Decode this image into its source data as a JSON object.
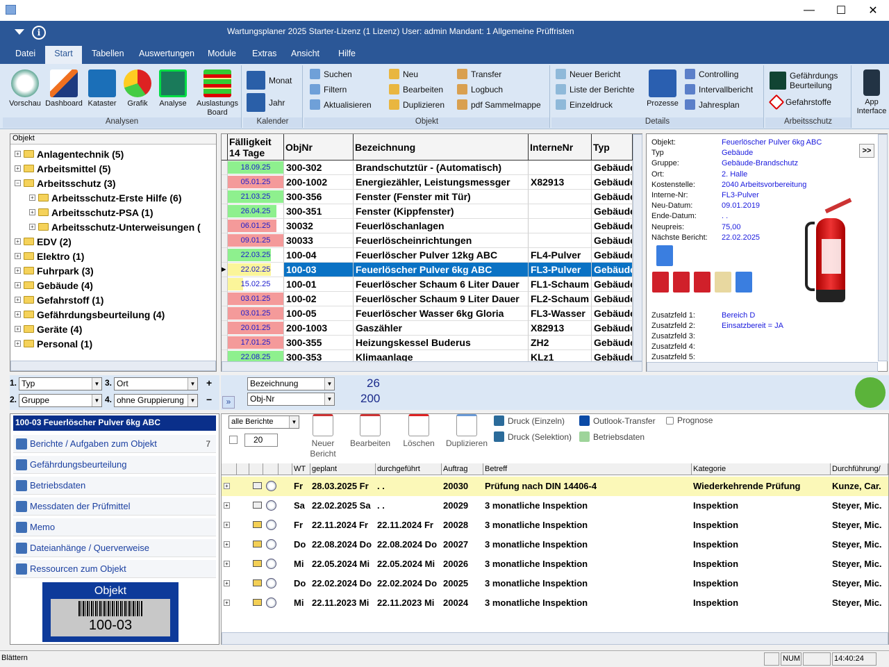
{
  "window": {
    "title": "Wartungsplaner 2025 Starter-Lizenz (1 Lizenz)   User: admin   Mandant: 1 Allgemeine Prüffristen",
    "minimize": "—",
    "maximize": "☐",
    "close": "✕"
  },
  "menu": [
    "Datei",
    "Start",
    "Tabellen",
    "Auswertungen",
    "Module",
    "Extras",
    "Ansicht",
    "Hilfe"
  ],
  "menu_active": "Start",
  "ribbon": {
    "analysen": {
      "label": "Analysen",
      "buttons": [
        "Vorschau",
        "Dashboard",
        "Kataster",
        "Grafik",
        "Analyse",
        "Auslastungs Board"
      ]
    },
    "kalender": {
      "label": "Kalender",
      "buttons": [
        "Monat",
        "Jahr"
      ]
    },
    "objekt": {
      "label": "Objekt",
      "col1": [
        "Suchen",
        "Filtern",
        "Aktualisieren"
      ],
      "col2": [
        "Neu",
        "Bearbeiten",
        "Duplizieren"
      ],
      "col3": [
        "Transfer",
        "Logbuch",
        "pdf Sammelmappe"
      ]
    },
    "details": {
      "label": "Details",
      "col1": [
        "Neuer Bericht",
        "Liste der Berichte",
        "Einzeldruck"
      ],
      "big": "Prozesse",
      "col2": [
        "Controlling",
        "Intervallbericht",
        "Jahresplan"
      ]
    },
    "arbeitsschutz": {
      "label": "Arbeitsschutz",
      "items": [
        "Gefährdungs Beurteilung",
        "Gefahrstoffe"
      ]
    },
    "app": {
      "label": "App Interface"
    }
  },
  "tree": {
    "header": "Objekt",
    "nodes": [
      {
        "label": "Anlagentechnik  (5)",
        "level": 0,
        "expanded": false
      },
      {
        "label": "Arbeitsmittel  (5)",
        "level": 0,
        "expanded": false
      },
      {
        "label": "Arbeitsschutz  (3)",
        "level": 0,
        "expanded": true
      },
      {
        "label": "Arbeitsschutz-Erste Hilfe  (6)",
        "level": 1,
        "expanded": false
      },
      {
        "label": "Arbeitsschutz-PSA  (1)",
        "level": 1,
        "expanded": false
      },
      {
        "label": "Arbeitsschutz-Unterweisungen  (",
        "level": 1,
        "expanded": false
      },
      {
        "label": "EDV  (2)",
        "level": 0,
        "expanded": false
      },
      {
        "label": "Elektro  (1)",
        "level": 0,
        "expanded": false
      },
      {
        "label": "Fuhrpark  (3)",
        "level": 0,
        "expanded": false
      },
      {
        "label": "Gebäude  (4)",
        "level": 0,
        "expanded": false
      },
      {
        "label": "Gefahrstoff  (1)",
        "level": 0,
        "expanded": false
      },
      {
        "label": "Gefährdungsbeurteilung  (4)",
        "level": 0,
        "expanded": false
      },
      {
        "label": "Geräte  (4)",
        "level": 0,
        "expanded": false
      },
      {
        "label": "Personal  (1)",
        "level": 0,
        "expanded": false
      }
    ]
  },
  "objects": {
    "columns": [
      "Fälligkeit 14 Tage",
      "ObjNr",
      "Bezeichnung",
      "InterneNr",
      "Typ"
    ],
    "colors": {
      "green": "#8ef08e",
      "red": "#f49a9a",
      "yellow": "#fbf59a",
      "selected": "#0a72c4"
    },
    "rows": [
      {
        "due": "18.09.25",
        "status": "green",
        "level": 1,
        "objnr": "300-302",
        "bez": "Brandschutztür - (Automatisch)",
        "intern": "",
        "typ": "Gebäude"
      },
      {
        "due": "05.01.25",
        "status": "red",
        "level": 1,
        "objnr": "200-1002",
        "bez": "Energiezähler, Leistungsmessger",
        "intern": "X82913",
        "typ": "Gebäude"
      },
      {
        "due": "21.03.25",
        "status": "green",
        "level": 1,
        "objnr": "300-356",
        "bez": "Fenster  (Fenster mit Tür)",
        "intern": "",
        "typ": "Gebäude"
      },
      {
        "due": "26.04.25",
        "status": "green",
        "level": 0.88,
        "objnr": "300-351",
        "bez": "Fenster  (Kippfenster)",
        "intern": "",
        "typ": "Gebäude"
      },
      {
        "due": "06.01.25",
        "status": "red",
        "level": 0.88,
        "objnr": "30032",
        "bez": "Feuerlöschanlagen",
        "intern": "",
        "typ": "Gebäude"
      },
      {
        "due": "09.01.25",
        "status": "red",
        "level": 1,
        "objnr": "30033",
        "bez": "Feuerlöscheinrichtungen",
        "intern": "",
        "typ": "Gebäude"
      },
      {
        "due": "22.03.25",
        "status": "green",
        "level": 0.78,
        "objnr": "100-04",
        "bez": "Feuerlöscher Pulver 12kg ABC",
        "intern": "FL4-Pulver",
        "typ": "Gebäude"
      },
      {
        "due": "22.02.25",
        "status": "yellow",
        "level": 0.78,
        "objnr": "100-03",
        "bez": "Feuerlöscher Pulver 6kg ABC",
        "intern": "FL3-Pulver",
        "typ": "Gebäude",
        "selected": true
      },
      {
        "due": "15.02.25",
        "status": "yellow",
        "level": 0.27,
        "objnr": "100-01",
        "bez": "Feuerlöscher Schaum 6 Liter Dauer",
        "intern": "FL1-Schaum",
        "typ": "Gebäude"
      },
      {
        "due": "03.01.25",
        "status": "red",
        "level": 1,
        "objnr": "100-02",
        "bez": "Feuerlöscher Schaum 9 Liter Dauer",
        "intern": "FL2-Schaum",
        "typ": "Gebäude"
      },
      {
        "due": "03.01.25",
        "status": "red",
        "level": 1,
        "objnr": "100-05",
        "bez": "Feuerlöscher Wasser 6kg Gloria",
        "intern": "FL3-Wasser",
        "typ": "Gebäude"
      },
      {
        "due": "20.01.25",
        "status": "red",
        "level": 1,
        "objnr": "200-1003",
        "bez": "Gaszähler",
        "intern": "X82913",
        "typ": "Gebäude"
      },
      {
        "due": "17.01.25",
        "status": "red",
        "level": 1,
        "objnr": "300-355",
        "bez": "Heizungskessel Buderus",
        "intern": "ZH2",
        "typ": "Gebäude"
      },
      {
        "due": "22.08.25",
        "status": "green",
        "level": 1,
        "objnr": "300-353",
        "bez": "Klimaanlage",
        "intern": "KLz1",
        "typ": "Gebäude"
      }
    ]
  },
  "detail": {
    "expand": ">>",
    "fields": [
      {
        "label": "Objekt:",
        "value": "Feuerlöscher Pulver 6kg ABC"
      },
      {
        "label": "Typ",
        "value": "Gebäude"
      },
      {
        "label": "Gruppe:",
        "value": "Gebäude-Brandschutz"
      },
      {
        "label": "Ort:",
        "value": "2. Halle"
      },
      {
        "label": "Kostenstelle:",
        "value": "2040 Arbeitsvorbereitung"
      },
      {
        "label": "Interne-Nr:",
        "value": "FL3-Pulver"
      },
      {
        "label": "Neu-Datum:",
        "value": "09.01.2019"
      },
      {
        "label": "Ende-Datum:",
        "value": ". ."
      },
      {
        "label": "Neupreis:",
        "value": "75,00"
      },
      {
        "label": "Nächste Bericht:",
        "value": "22.02.2025"
      }
    ],
    "extra": [
      {
        "label": "Zusatzfeld 1:",
        "value": "Bereich D"
      },
      {
        "label": "Zusatzfeld 2:",
        "value": "Einsatzbereit = JA"
      },
      {
        "label": "Zusatzfeld 3:",
        "value": ""
      },
      {
        "label": "Zusatzfeld 4:",
        "value": ""
      },
      {
        "label": "Zusatzfeld 5:",
        "value": ""
      }
    ],
    "attachments": [
      "doc",
      "pdf",
      "pdf",
      "pdf",
      "map",
      "doc"
    ]
  },
  "filter": {
    "g1_num": "1.",
    "g1": "Typ",
    "g2_num": "2.",
    "g2": "Gruppe",
    "g3_num": "3.",
    "g3": "Ort",
    "g4_num": "4.",
    "g4": "ohne Gruppierung",
    "add": "+",
    "remove": "−"
  },
  "sort": {
    "s1": "Bezeichnung",
    "s2": "Obj-Nr",
    "count1": "26",
    "count2": "200",
    "collapse": "»"
  },
  "left": {
    "selected": "100-03 Feuerlöscher Pulver 6kg ABC",
    "items": [
      {
        "label": "Berichte / Aufgaben zum Objekt",
        "count": "7"
      },
      {
        "label": "Gefährdungsbeurteilung",
        "count": ""
      },
      {
        "label": "Betriebsdaten",
        "count": ""
      },
      {
        "label": "Messdaten der Prüfmittel",
        "count": ""
      },
      {
        "label": "Memo",
        "count": ""
      },
      {
        "label": "Dateianhänge / Querverweise",
        "count": ""
      },
      {
        "label": "Ressourcen zum Objekt",
        "count": ""
      }
    ],
    "barcode": {
      "title": "Objekt",
      "code": "100-03"
    }
  },
  "reports_toolbar": {
    "filter": "alle Berichte",
    "count": "20",
    "buttons": [
      "Neuer Bericht",
      "Bearbeiten",
      "Löschen",
      "Duplizieren"
    ],
    "print1": "Druck (Einzeln)",
    "print2": "Druck (Selektion)",
    "outlook": "Outlook-Transfer",
    "betrieb": "Betriebsdaten",
    "prognose": "Prognose"
  },
  "reports": {
    "columns": [
      "",
      "",
      "",
      "",
      "WT",
      "geplant",
      "durchgeführt",
      "Auftrag",
      "Betreff",
      "Kategorie",
      "Durchführung/"
    ],
    "rows": [
      {
        "wt": "Fr",
        "geplant": "28.03.2025 Fr",
        "durch": ". .",
        "auftrag": "20030",
        "betreff": "Prüfung nach DIN 14406-4",
        "kategorie": "Wiederkehrende Prüfung",
        "durchf": "Kunze, Car.",
        "highlight": true,
        "mail": "open"
      },
      {
        "wt": "Sa",
        "geplant": "22.02.2025 Sa",
        "durch": ". .",
        "auftrag": "20029",
        "betreff": "3 monatliche Inspektion",
        "kategorie": "Inspektion",
        "durchf": "Steyer, Mic.",
        "mail": "open"
      },
      {
        "wt": "Fr",
        "geplant": "22.11.2024 Fr",
        "durch": "22.11.2024 Fr",
        "auftrag": "20028",
        "betreff": "3 monatliche Inspektion",
        "kategorie": "Inspektion",
        "durchf": "Steyer, Mic.",
        "mail": "closed"
      },
      {
        "wt": "Do",
        "geplant": "22.08.2024 Do",
        "durch": "22.08.2024 Do",
        "auftrag": "20027",
        "betreff": "3 monatliche Inspektion",
        "kategorie": "Inspektion",
        "durchf": "Steyer, Mic.",
        "mail": "closed"
      },
      {
        "wt": "Mi",
        "geplant": "22.05.2024 Mi",
        "durch": "22.05.2024 Mi",
        "auftrag": "20026",
        "betreff": "3 monatliche Inspektion",
        "kategorie": "Inspektion",
        "durchf": "Steyer, Mic.",
        "mail": "closed"
      },
      {
        "wt": "Do",
        "geplant": "22.02.2024 Do",
        "durch": "22.02.2024 Do",
        "auftrag": "20025",
        "betreff": "3 monatliche Inspektion",
        "kategorie": "Inspektion",
        "durchf": "Steyer, Mic.",
        "mail": "closed"
      },
      {
        "wt": "Mi",
        "geplant": "22.11.2023 Mi",
        "durch": "22.11.2023 Mi",
        "auftrag": "20024",
        "betreff": "3 monatliche Inspektion",
        "kategorie": "Inspektion",
        "durchf": "Steyer, Mic.",
        "mail": "closed"
      }
    ]
  },
  "statusbar": {
    "text": "Blättern",
    "num": "NUM",
    "time": "14:40:24"
  }
}
